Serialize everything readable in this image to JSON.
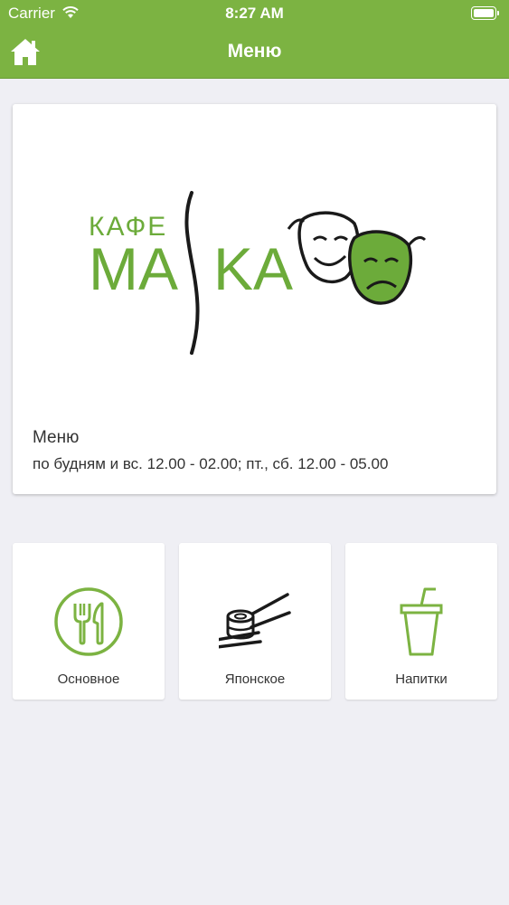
{
  "status_bar": {
    "carrier": "Carrier",
    "time": "8:27 AM"
  },
  "nav": {
    "title": "Меню",
    "home_icon": "home-icon"
  },
  "colors": {
    "accent": "#7cb342",
    "background": "#efeff4",
    "logo_green": "#6cab3a"
  },
  "card": {
    "logo": {
      "kafe": "КАФЕ",
      "maska_left": "MA",
      "maska_right": "KA"
    },
    "title": "Меню",
    "subtitle": "по будням и вс. 12.00 - 02.00; пт., сб. 12.00 - 05.00"
  },
  "categories": [
    {
      "label": "Основное",
      "icon": "fork-knife-icon"
    },
    {
      "label": "Японское",
      "icon": "sushi-chopsticks-icon"
    },
    {
      "label": "Напитки",
      "icon": "drink-cup-icon"
    }
  ]
}
